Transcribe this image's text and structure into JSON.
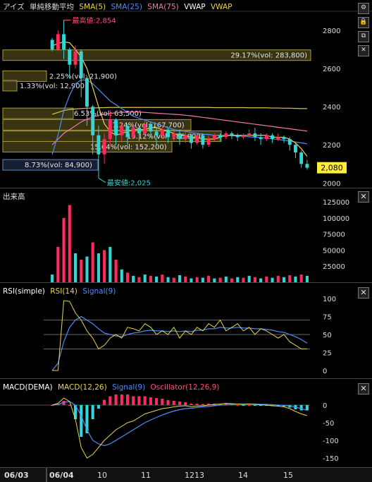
{
  "main": {
    "legend": {
      "title": "アイズ",
      "indicator": "単純移動平均",
      "items": [
        {
          "label": "SMA(5)",
          "color": "#e8d44d"
        },
        {
          "label": "SMA(25)",
          "color": "#4f8df7"
        },
        {
          "label": "SMA(75)",
          "color": "#f07aa8"
        },
        {
          "label": "VWAP",
          "color": "#ffffff"
        },
        {
          "label": "VWAP",
          "color": "#e8d44d"
        }
      ]
    },
    "high_label": "最高値:2,854",
    "low_label": "最安値:2,025",
    "current_price": "2,080",
    "volume_profile": [
      {
        "label": "29.17%(vol: 283,800)"
      },
      {
        "label": "2.25%(vol: 21,900)"
      },
      {
        "label": "1.33%(vol: 12,900)"
      },
      {
        "label": "6.53%(vol: 63,500)"
      },
      {
        "label": "17.24%(vol: 167,700)"
      },
      {
        "label": "19.12%(vol: 186,000)"
      },
      {
        "label": "15.64%(vol: 152,200)"
      },
      {
        "label": "8.73%(vol: 84,900)"
      }
    ],
    "y_ticks": [
      "2800",
      "2600",
      "2400",
      "2200",
      "2000"
    ]
  },
  "volume": {
    "title": "出来高",
    "y_ticks": [
      "125000",
      "100000",
      "75000",
      "50000",
      "25000"
    ]
  },
  "rsi": {
    "legend": [
      {
        "label": "RSI(simple)",
        "color": "#ffffff"
      },
      {
        "label": "RSI(14)",
        "color": "#e8d44d"
      },
      {
        "label": "Signal(9)",
        "color": "#4f8df7"
      }
    ],
    "y_ticks": [
      "100",
      "75",
      "50",
      "25",
      "0"
    ]
  },
  "macd": {
    "legend": [
      {
        "label": "MACD(DEMA)",
        "color": "#ffffff"
      },
      {
        "label": "MACD(12,26)",
        "color": "#e8d44d"
      },
      {
        "label": "Signal(9)",
        "color": "#4f8df7"
      },
      {
        "label": "Oscillator(12,26,9)",
        "color": "#ff4f7a"
      }
    ],
    "y_ticks": [
      "0",
      "-50",
      "-100",
      "-150"
    ]
  },
  "dates": [
    "06/03",
    "06/04",
    "10",
    "11",
    "12",
    "13",
    "14",
    "15"
  ],
  "close_symbol": "✕",
  "chart_data": {
    "type": "candlestick",
    "ylim": [
      1990,
      2900
    ],
    "price_series": [
      {
        "o": 2750,
        "c": 2700,
        "h": 2760,
        "l": 2690
      },
      {
        "o": 2700,
        "c": 2780,
        "h": 2800,
        "l": 2690
      },
      {
        "o": 2780,
        "c": 2700,
        "h": 2854,
        "l": 2650
      },
      {
        "o": 2700,
        "c": 2620,
        "h": 2710,
        "l": 2550
      },
      {
        "o": 2620,
        "c": 2690,
        "h": 2720,
        "l": 2600
      },
      {
        "o": 2690,
        "c": 2550,
        "h": 2700,
        "l": 2450
      },
      {
        "o": 2550,
        "c": 2400,
        "h": 2560,
        "l": 2300
      },
      {
        "o": 2400,
        "c": 2250,
        "h": 2410,
        "l": 2150
      },
      {
        "o": 2250,
        "c": 2150,
        "h": 2300,
        "l": 2025
      },
      {
        "o": 2150,
        "c": 2230,
        "h": 2260,
        "l": 2100
      },
      {
        "o": 2230,
        "c": 2330,
        "h": 2380,
        "l": 2200
      },
      {
        "o": 2330,
        "c": 2250,
        "h": 2340,
        "l": 2200
      },
      {
        "o": 2250,
        "c": 2300,
        "h": 2320,
        "l": 2220
      },
      {
        "o": 2300,
        "c": 2240,
        "h": 2310,
        "l": 2200
      },
      {
        "o": 2240,
        "c": 2290,
        "h": 2310,
        "l": 2230
      },
      {
        "o": 2290,
        "c": 2260,
        "h": 2300,
        "l": 2220
      },
      {
        "o": 2260,
        "c": 2310,
        "h": 2330,
        "l": 2240
      },
      {
        "o": 2310,
        "c": 2270,
        "h": 2320,
        "l": 2240
      },
      {
        "o": 2270,
        "c": 2250,
        "h": 2290,
        "l": 2200
      },
      {
        "o": 2250,
        "c": 2280,
        "h": 2300,
        "l": 2230
      },
      {
        "o": 2280,
        "c": 2240,
        "h": 2290,
        "l": 2210
      },
      {
        "o": 2240,
        "c": 2260,
        "h": 2270,
        "l": 2220
      },
      {
        "o": 2260,
        "c": 2230,
        "h": 2280,
        "l": 2200
      },
      {
        "o": 2230,
        "c": 2250,
        "h": 2270,
        "l": 2210
      },
      {
        "o": 2250,
        "c": 2210,
        "h": 2260,
        "l": 2180
      },
      {
        "o": 2210,
        "c": 2250,
        "h": 2260,
        "l": 2200
      },
      {
        "o": 2250,
        "c": 2200,
        "h": 2260,
        "l": 2180
      },
      {
        "o": 2200,
        "c": 2230,
        "h": 2250,
        "l": 2190
      },
      {
        "o": 2230,
        "c": 2250,
        "h": 2260,
        "l": 2220
      },
      {
        "o": 2250,
        "c": 2240,
        "h": 2260,
        "l": 2220
      },
      {
        "o": 2240,
        "c": 2260,
        "h": 2270,
        "l": 2230
      },
      {
        "o": 2260,
        "c": 2250,
        "h": 2270,
        "l": 2230
      },
      {
        "o": 2250,
        "c": 2240,
        "h": 2260,
        "l": 2220
      },
      {
        "o": 2240,
        "c": 2250,
        "h": 2260,
        "l": 2230
      },
      {
        "o": 2250,
        "c": 2260,
        "h": 2280,
        "l": 2240
      },
      {
        "o": 2260,
        "c": 2240,
        "h": 2290,
        "l": 2220
      },
      {
        "o": 2240,
        "c": 2230,
        "h": 2260,
        "l": 2200
      },
      {
        "o": 2230,
        "c": 2250,
        "h": 2260,
        "l": 2220
      },
      {
        "o": 2250,
        "c": 2230,
        "h": 2260,
        "l": 2210
      },
      {
        "o": 2230,
        "c": 2240,
        "h": 2260,
        "l": 2220
      },
      {
        "o": 2240,
        "c": 2230,
        "h": 2250,
        "l": 2210
      },
      {
        "o": 2230,
        "c": 2200,
        "h": 2240,
        "l": 2170
      },
      {
        "o": 2200,
        "c": 2160,
        "h": 2210,
        "l": 2130
      },
      {
        "o": 2160,
        "c": 2100,
        "h": 2170,
        "l": 2080
      },
      {
        "o": 2100,
        "c": 2080,
        "h": 2120,
        "l": 2070
      }
    ],
    "sma5": [
      2720,
      2730,
      2740,
      2735,
      2700,
      2660,
      2600,
      2500,
      2400,
      2310,
      2270,
      2250,
      2260,
      2270,
      2280,
      2280,
      2280,
      2290,
      2290,
      2280,
      2270,
      2260,
      2250,
      2250,
      2240,
      2240,
      2230,
      2230,
      2230,
      2240,
      2250,
      2250,
      2250,
      2250,
      2250,
      2250,
      2250,
      2250,
      2240,
      2240,
      2240,
      2230,
      2210,
      2180,
      2140
    ],
    "sma25": [
      2150,
      2250,
      2380,
      2460,
      2520,
      2540,
      2540,
      2520,
      2490,
      2460,
      2430,
      2410,
      2390,
      2370,
      2350,
      2340,
      2330,
      2320,
      2310,
      2300,
      2290,
      2280,
      2275,
      2270,
      2265,
      2260,
      2255,
      2255,
      2250,
      2250,
      2250,
      2248,
      2246,
      2244,
      2242,
      2240,
      2238,
      2236,
      2232,
      2228,
      2224,
      2220,
      2215,
      2210,
      2205
    ],
    "sma75": [
      2200,
      2230,
      2260,
      2280,
      2300,
      2320,
      2335,
      2345,
      2355,
      2360,
      2365,
      2368,
      2370,
      2372,
      2372,
      2372,
      2370,
      2368,
      2366,
      2364,
      2362,
      2360,
      2358,
      2355,
      2352,
      2348,
      2344,
      2340,
      2336,
      2332,
      2328,
      2324,
      2320,
      2316,
      2312,
      2308,
      2304,
      2300,
      2296,
      2292,
      2288,
      2284,
      2280,
      2276,
      2272
    ],
    "vwap": [
      2360,
      2370,
      2380,
      2385,
      2388,
      2390,
      2392,
      2393,
      2394,
      2395,
      2396,
      2396,
      2396,
      2396,
      2396,
      2396,
      2396,
      2396,
      2396,
      2396,
      2396,
      2396,
      2396,
      2396,
      2396,
      2396,
      2396,
      2396,
      2395,
      2395,
      2395,
      2395,
      2395,
      2395,
      2394,
      2394,
      2394,
      2394,
      2393,
      2393,
      2392,
      2392,
      2391,
      2390,
      2390
    ],
    "volume": [
      {
        "v": 12000,
        "up": false
      },
      {
        "v": 55000,
        "up": true
      },
      {
        "v": 100000,
        "up": true
      },
      {
        "v": 120000,
        "up": true
      },
      {
        "v": 45000,
        "up": false
      },
      {
        "v": 35000,
        "up": true
      },
      {
        "v": 40000,
        "up": false
      },
      {
        "v": 62000,
        "up": true
      },
      {
        "v": 45000,
        "up": false
      },
      {
        "v": 50000,
        "up": true
      },
      {
        "v": 55000,
        "up": false
      },
      {
        "v": 35000,
        "up": true
      },
      {
        "v": 20000,
        "up": false
      },
      {
        "v": 15000,
        "up": true
      },
      {
        "v": 10000,
        "up": false
      },
      {
        "v": 8000,
        "up": true
      },
      {
        "v": 12000,
        "up": false
      },
      {
        "v": 10000,
        "up": true
      },
      {
        "v": 9000,
        "up": false
      },
      {
        "v": 12000,
        "up": true
      },
      {
        "v": 8000,
        "up": false
      },
      {
        "v": 7000,
        "up": true
      },
      {
        "v": 11000,
        "up": false
      },
      {
        "v": 9000,
        "up": true
      },
      {
        "v": 6000,
        "up": false
      },
      {
        "v": 8000,
        "up": true
      },
      {
        "v": 7000,
        "up": false
      },
      {
        "v": 10000,
        "up": true
      },
      {
        "v": 6000,
        "up": false
      },
      {
        "v": 7000,
        "up": true
      },
      {
        "v": 9000,
        "up": false
      },
      {
        "v": 6000,
        "up": true
      },
      {
        "v": 8000,
        "up": false
      },
      {
        "v": 7000,
        "up": true
      },
      {
        "v": 10000,
        "up": false
      },
      {
        "v": 8000,
        "up": true
      },
      {
        "v": 6000,
        "up": false
      },
      {
        "v": 9000,
        "up": true
      },
      {
        "v": 7000,
        "up": false
      },
      {
        "v": 10000,
        "up": true
      },
      {
        "v": 8000,
        "up": false
      },
      {
        "v": 11000,
        "up": true
      },
      {
        "v": 9000,
        "up": false
      },
      {
        "v": 12000,
        "up": true
      },
      {
        "v": 10000,
        "up": false
      }
    ],
    "rsi": [
      0,
      0,
      97,
      96,
      80,
      70,
      55,
      45,
      30,
      35,
      45,
      50,
      45,
      60,
      58,
      55,
      65,
      60,
      50,
      55,
      50,
      60,
      45,
      55,
      50,
      60,
      55,
      65,
      60,
      70,
      55,
      60,
      65,
      55,
      60,
      50,
      58,
      55,
      50,
      45,
      50,
      40,
      35,
      30,
      30
    ],
    "rsi_signal": [
      0,
      10,
      40,
      60,
      70,
      75,
      70,
      65,
      58,
      52,
      50,
      48,
      47,
      50,
      52,
      53,
      55,
      56,
      55,
      55,
      54,
      55,
      54,
      55,
      54,
      56,
      56,
      58,
      58,
      60,
      59,
      59,
      60,
      59,
      59,
      58,
      58,
      57,
      56,
      54,
      53,
      50,
      47,
      43,
      38
    ],
    "macd": [
      0,
      5,
      20,
      10,
      -40,
      -120,
      -150,
      -140,
      -120,
      -100,
      -85,
      -70,
      -60,
      -50,
      -45,
      -35,
      -25,
      -20,
      -15,
      -10,
      -8,
      -5,
      -3,
      -2,
      -5,
      -3,
      -2,
      0,
      2,
      3,
      5,
      4,
      3,
      2,
      3,
      2,
      1,
      0,
      -2,
      -3,
      -5,
      -10,
      -18,
      -25,
      -30
    ],
    "macd_signal": [
      0,
      2,
      8,
      10,
      0,
      -30,
      -70,
      -100,
      -110,
      -115,
      -110,
      -100,
      -90,
      -80,
      -70,
      -60,
      -50,
      -42,
      -35,
      -28,
      -22,
      -17,
      -13,
      -10,
      -9,
      -7,
      -5,
      -4,
      -2,
      0,
      1,
      2,
      3,
      3,
      3,
      3,
      2,
      2,
      1,
      0,
      -1,
      -3,
      -6,
      -10,
      -15
    ],
    "macd_osc": [
      0,
      3,
      12,
      0,
      -40,
      -90,
      -80,
      -40,
      -10,
      15,
      25,
      30,
      30,
      30,
      25,
      25,
      25,
      22,
      20,
      18,
      14,
      12,
      10,
      8,
      4,
      4,
      3,
      4,
      4,
      3,
      4,
      2,
      0,
      -1,
      0,
      -1,
      -1,
      -2,
      -3,
      -3,
      -4,
      -7,
      -12,
      -15,
      -15
    ],
    "macd_ylim": [
      -170,
      30
    ]
  }
}
